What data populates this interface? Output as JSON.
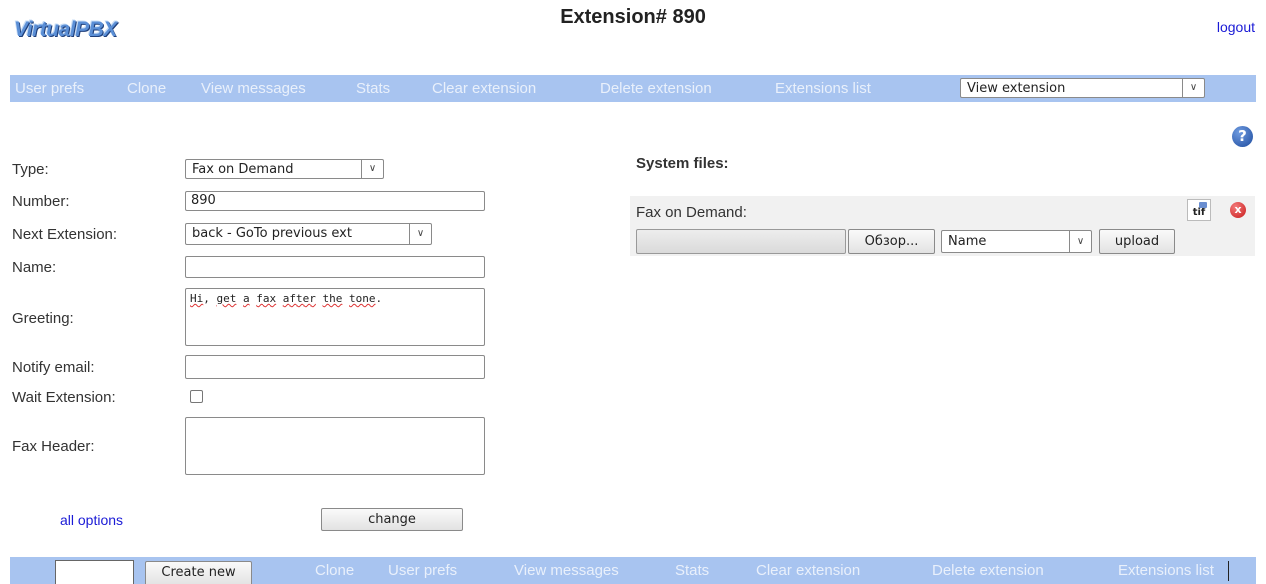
{
  "header": {
    "logo": "VirtualPBX",
    "title": "Extension# 890",
    "logout": "logout"
  },
  "top_nav": {
    "links": [
      "User prefs",
      "Clone",
      "View messages",
      "Stats",
      "Clear extension",
      "Delete extension",
      "Extensions list"
    ],
    "view_select": "View extension"
  },
  "help_icon": "?",
  "form": {
    "type_label": "Type:",
    "type_value": "Fax on Demand",
    "number_label": "Number:",
    "number_value": "890",
    "next_ext_label": "Next Extension:",
    "next_ext_value": "back - GoTo previous ext",
    "name_label": "Name:",
    "name_value": "",
    "greeting_label": "Greeting:",
    "greeting_words": [
      "Hi",
      ", ",
      "get",
      " ",
      "a",
      " ",
      "fax",
      " ",
      "after",
      " ",
      "the",
      " ",
      "tone",
      "."
    ],
    "notify_label": "Notify email:",
    "notify_value": "",
    "wait_label": "Wait Extension:",
    "wait_checked": false,
    "fax_header_label": "Fax Header:",
    "fax_header_value": "",
    "all_options": "all options",
    "change_button": "change"
  },
  "system_files": {
    "title": "System files:",
    "fax_on_demand_label": "Fax on Demand:",
    "file_icon": "tif",
    "delete_icon": "x",
    "browse_button": "Обзор...",
    "name_select": "Name",
    "upload_button": "upload"
  },
  "bottom_nav": {
    "create_new": "Create new",
    "links": [
      "Clone",
      "User prefs",
      "View messages",
      "Stats",
      "Clear extension",
      "Delete extension",
      "Extensions list"
    ]
  },
  "colors": {
    "navbar": "#a8c4f0",
    "nav_text": "#e9f0fb",
    "link": "#1a1ad6"
  }
}
